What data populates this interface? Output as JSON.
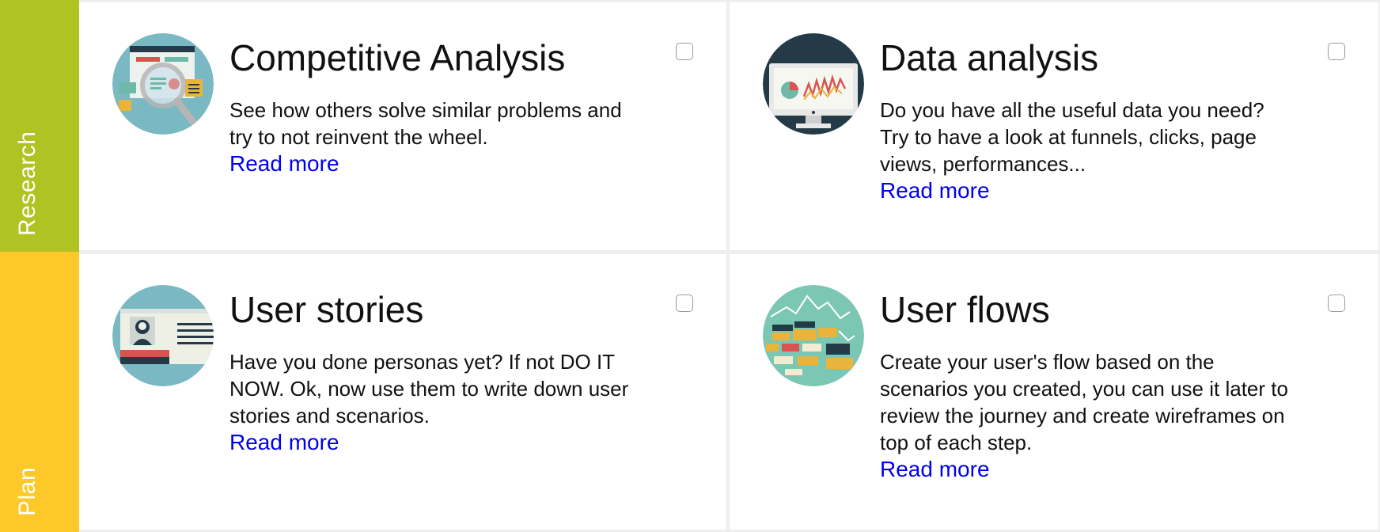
{
  "phases": {
    "research": {
      "label": "Research",
      "color": "#b0c323"
    },
    "plan": {
      "label": "Plan",
      "color": "#fcc928"
    }
  },
  "cards": {
    "competitive_analysis": {
      "title": "Competitive Analysis",
      "description": "See how others solve similar problems and try to not reinvent the wheel.",
      "link": "Read more",
      "icon": "magnifier-webpage-icon",
      "checked": false
    },
    "data_analysis": {
      "title": "Data analysis",
      "description": "Do you have all the useful data you need? Try to have a look at funnels, clicks, page views, performances...",
      "link": "Read more",
      "icon": "monitor-chart-icon",
      "checked": false
    },
    "user_stories": {
      "title": "User stories",
      "description": "Have you done personas yet? If not DO IT NOW. Ok, now use them to write down user stories and scenarios.",
      "link": "Read more",
      "icon": "id-card-icon",
      "checked": false
    },
    "user_flows": {
      "title": "User flows",
      "description": "Create your user's flow based on the scenarios you created, you can use it later to review the journey and create wireframes on top of each step.",
      "link": "Read more",
      "icon": "flow-diagram-icon",
      "checked": false
    }
  },
  "colors": {
    "link": "#0000ee",
    "icon_blue": "#7ab8c4",
    "icon_dark": "#243b47",
    "icon_teal": "#7cc7b3"
  }
}
